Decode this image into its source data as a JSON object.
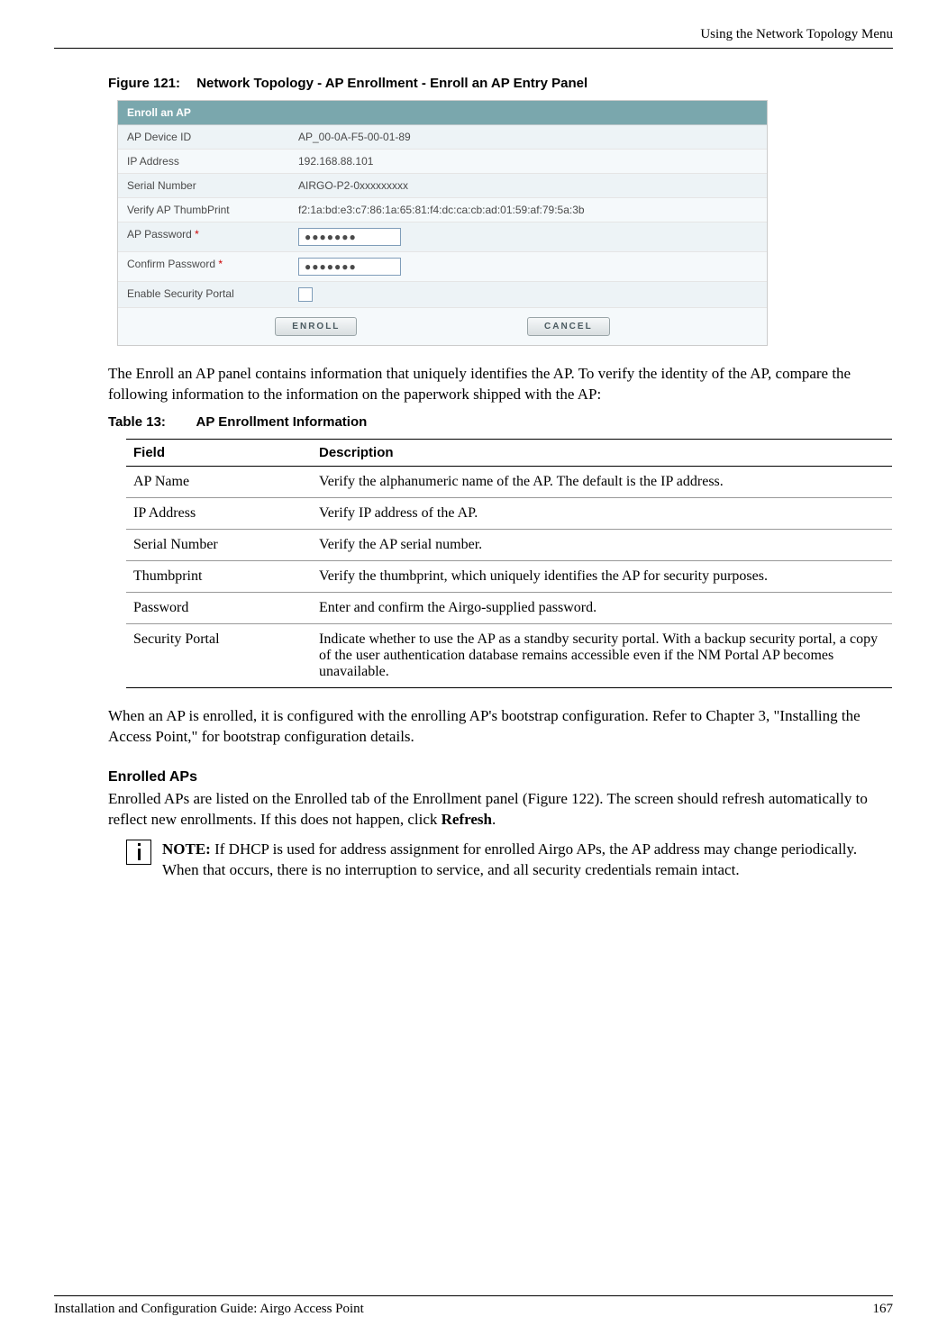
{
  "header": {
    "section_title": "Using the Network Topology Menu"
  },
  "figure": {
    "number": "Figure 121:",
    "title": "Network Topology - AP Enrollment - Enroll an AP Entry Panel"
  },
  "screenshot": {
    "panel_title": "Enroll an AP",
    "rows": {
      "device_id_label": "AP Device ID",
      "device_id_value": "AP_00-0A-F5-00-01-89",
      "ip_label": "IP Address",
      "ip_value": "192.168.88.101",
      "serial_label": "Serial Number",
      "serial_value": "AIRGO-P2-0xxxxxxxxx",
      "thumb_label": "Verify AP ThumbPrint",
      "thumb_value": "f2:1a:bd:e3:c7:86:1a:65:81:f4:dc:ca:cb:ad:01:59:af:79:5a:3b",
      "pw_label": "AP Password",
      "pw_value": "●●●●●●●",
      "cpw_label": "Confirm Password",
      "cpw_value": "●●●●●●●",
      "sec_portal_label": "Enable Security Portal",
      "required_mark": "*"
    },
    "buttons": {
      "enroll": "ENROLL",
      "cancel": "CANCEL"
    }
  },
  "paragraphs": {
    "p1": "The Enroll an AP panel contains information that uniquely identifies the AP. To verify the identity of the AP, compare the following information to the information on the paperwork shipped with the AP:",
    "p2": "When an AP is enrolled, it is configured with the enrolling AP's bootstrap configuration. Refer to Chapter 3, \"Installing the Access Point,\" for bootstrap configuration details.",
    "subhead": "Enrolled APs",
    "p3_part1": "Enrolled APs are listed on the Enrolled tab of the Enrollment panel (Figure 122). The screen should refresh automatically to reflect new enrollments. If this does not happen, click ",
    "p3_bold": "Refresh",
    "p3_part2": "."
  },
  "table": {
    "number": "Table 13:",
    "title": "AP Enrollment Information",
    "headers": {
      "field": "Field",
      "desc": "Description"
    },
    "rows": [
      {
        "field": "AP Name",
        "desc": "Verify the alphanumeric name of the AP. The default is the IP address."
      },
      {
        "field": "IP Address",
        "desc": "Verify IP address of the AP."
      },
      {
        "field": "Serial Number",
        "desc": "Verify the AP serial number."
      },
      {
        "field": "Thumbprint",
        "desc": "Verify the thumbprint, which uniquely identifies the AP for security purposes."
      },
      {
        "field": "Password",
        "desc": "Enter and confirm the Airgo-supplied password."
      },
      {
        "field": "Security Portal",
        "desc": "Indicate whether to use the AP as a standby security portal. With a backup security portal, a copy of the user authentication database remains accessible even if the NM Portal AP becomes unavailable."
      }
    ]
  },
  "note": {
    "label": "NOTE:",
    "text": " If DHCP is used for address assignment for enrolled Airgo APs, the AP address may change periodically. When that occurs, there is no interruption to service, and all security credentials remain intact."
  },
  "footer": {
    "doc_title": "Installation and Configuration Guide: Airgo Access Point",
    "page_num": "167"
  }
}
